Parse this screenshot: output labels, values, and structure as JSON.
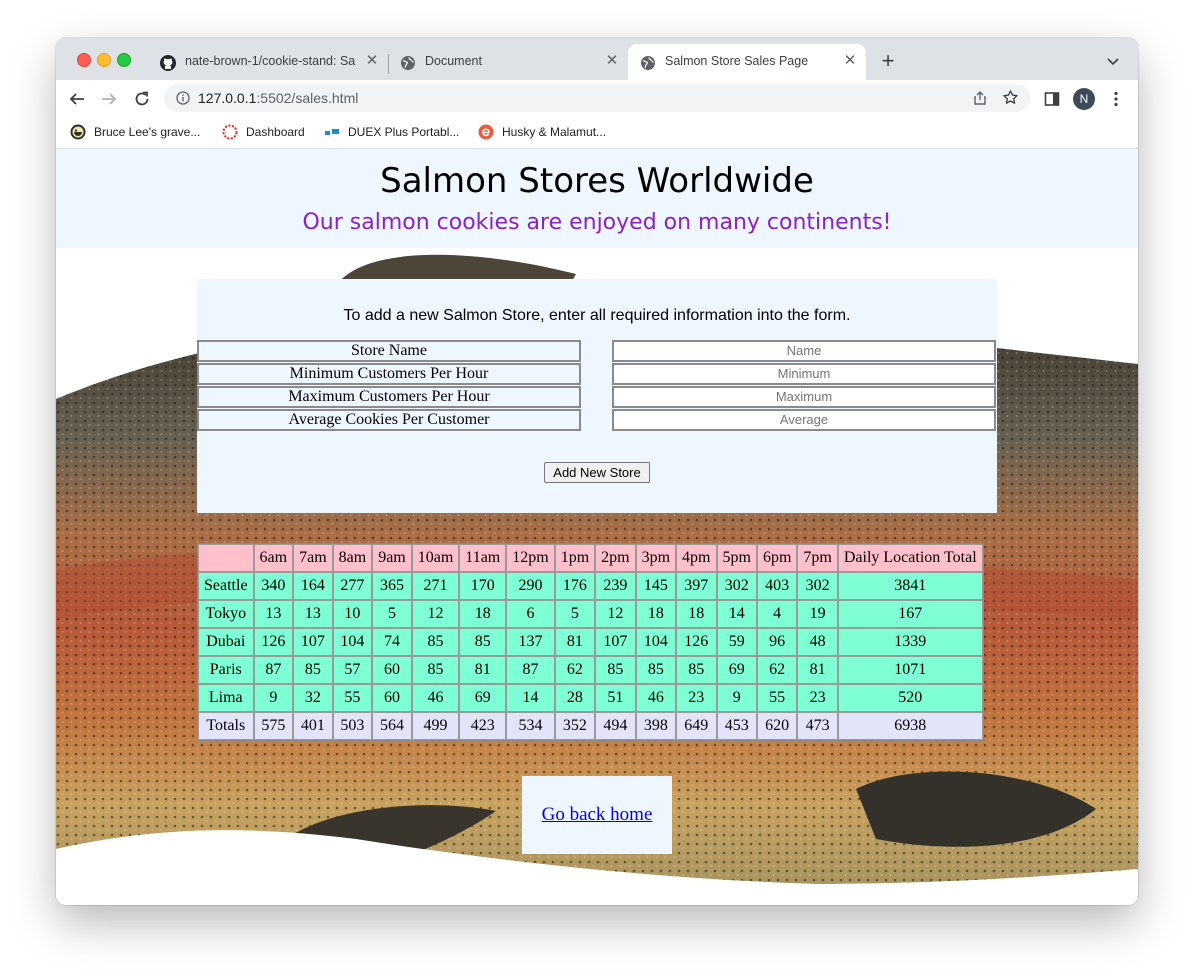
{
  "browser": {
    "tabs": [
      {
        "title": "nate-brown-1/cookie-stand: Sa",
        "icon": "github-icon",
        "active": false
      },
      {
        "title": "Document",
        "icon": "globe-icon",
        "active": false
      },
      {
        "title": "Salmon Store Sales Page",
        "icon": "globe-icon",
        "active": true
      }
    ],
    "url_host": "127.0.0.1",
    "url_rest": ":5502/sales.html",
    "avatar_initial": "N",
    "bookmarks": [
      {
        "label": "Bruce Lee's grave...",
        "icon": "bruce-lee-favicon"
      },
      {
        "label": "Dashboard",
        "icon": "dashboard-favicon"
      },
      {
        "label": "DUEX Plus Portabl...",
        "icon": "duex-favicon"
      },
      {
        "label": "Husky & Malamut...",
        "icon": "husky-favicon"
      }
    ]
  },
  "page": {
    "title": "Salmon Stores Worldwide",
    "subtitle": "Our salmon cookies are enjoyed on many continents!",
    "form": {
      "instructions": "To add a new Salmon Store, enter all required information into the form.",
      "labels": [
        "Store Name",
        "Minimum Customers Per Hour",
        "Maximum Customers Per Hour",
        "Average Cookies Per Customer"
      ],
      "placeholders": [
        "Name",
        "Minimum",
        "Maximum",
        "Average"
      ],
      "submit_label": "Add New Store"
    },
    "table": {
      "headers": [
        "",
        "6am",
        "7am",
        "8am",
        "9am",
        "10am",
        "11am",
        "12pm",
        "1pm",
        "2pm",
        "3pm",
        "4pm",
        "5pm",
        "6pm",
        "7pm",
        "Daily Location Total"
      ],
      "rows": [
        [
          "Seattle",
          "340",
          "164",
          "277",
          "365",
          "271",
          "170",
          "290",
          "176",
          "239",
          "145",
          "397",
          "302",
          "403",
          "302",
          "3841"
        ],
        [
          "Tokyo",
          "13",
          "13",
          "10",
          "5",
          "12",
          "18",
          "6",
          "5",
          "12",
          "18",
          "18",
          "14",
          "4",
          "19",
          "167"
        ],
        [
          "Dubai",
          "126",
          "107",
          "104",
          "74",
          "85",
          "85",
          "137",
          "81",
          "107",
          "104",
          "126",
          "59",
          "96",
          "48",
          "1339"
        ],
        [
          "Paris",
          "87",
          "85",
          "57",
          "60",
          "85",
          "81",
          "87",
          "62",
          "85",
          "85",
          "85",
          "69",
          "62",
          "81",
          "1071"
        ],
        [
          "Lima",
          "9",
          "32",
          "55",
          "60",
          "46",
          "69",
          "14",
          "28",
          "51",
          "46",
          "23",
          "9",
          "55",
          "23",
          "520"
        ]
      ],
      "totals": [
        "Totals",
        "575",
        "401",
        "503",
        "564",
        "499",
        "423",
        "534",
        "352",
        "494",
        "398",
        "649",
        "453",
        "620",
        "473",
        "6938"
      ]
    },
    "home_link": "Go back home"
  },
  "colors": {
    "header_bg": "#eef6ff",
    "subtitle": "#8b22c9",
    "table_header_bg": "#ffc0cb",
    "table_cell_bg": "#7fffd4",
    "totals_bg": "#e3e4fa",
    "link": "#0000ee"
  }
}
